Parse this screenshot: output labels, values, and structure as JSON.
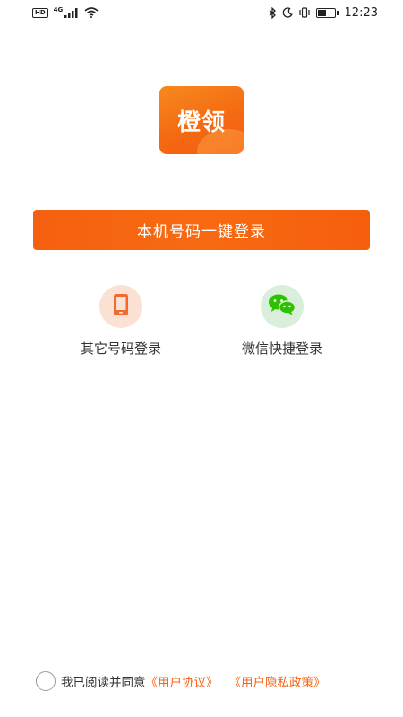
{
  "status_bar": {
    "hd_badge": "HD",
    "network": "4G",
    "time": "12:23",
    "battery_level": 0.55
  },
  "logo": {
    "text": "橙领"
  },
  "primary_login": {
    "label": "本机号码一键登录"
  },
  "alt_logins": [
    {
      "label": "其它号码登录",
      "icon": "phone-icon"
    },
    {
      "label": "微信快捷登录",
      "icon": "wechat-icon"
    }
  ],
  "agreement": {
    "prefix": "我已阅读并同意",
    "user_agreement": "《用户协议》",
    "privacy_policy": "《用户隐私政策》",
    "checked": false
  },
  "colors": {
    "accent": "#f56010",
    "link": "#f3651a",
    "phone_icon": "#f26b2b",
    "wechat_icon": "#2dc100"
  }
}
